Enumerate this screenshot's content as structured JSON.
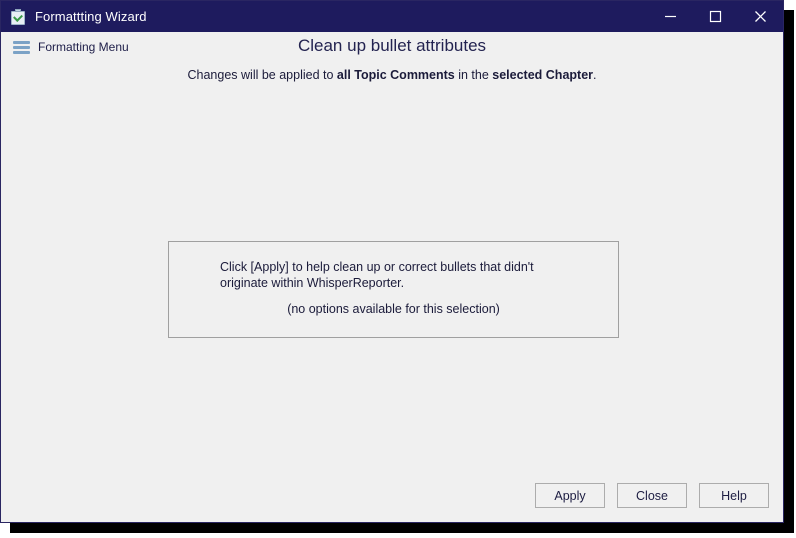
{
  "window": {
    "title": "Formattting Wizard",
    "icon": "clipboard-check-icon",
    "accent_navy": "#1e1b5e",
    "body_background": "#f0f0f0",
    "controls": {
      "minimize": "minimize-icon",
      "maximize": "maximize-icon",
      "close": "close-icon"
    }
  },
  "menu": {
    "icon": "hamburger-icon",
    "label": "Formatting Menu",
    "icon_color": "#7ba2c6"
  },
  "header": {
    "title": "Clean up bullet attributes",
    "subtitle": {
      "part1": "Changes will be applied to ",
      "bold1": "all Topic Comments",
      "part2": " in the ",
      "bold2": "selected Chapter",
      "part3": "."
    }
  },
  "panel": {
    "description": "Click [Apply] to help clean up or correct bullets that didn't originate within WhisperReporter.",
    "note": "(no options available for this selection)",
    "border_color": "#a0a0a0"
  },
  "footer": {
    "buttons": [
      {
        "label": "Apply"
      },
      {
        "label": "Close"
      },
      {
        "label": "Help"
      }
    ]
  }
}
